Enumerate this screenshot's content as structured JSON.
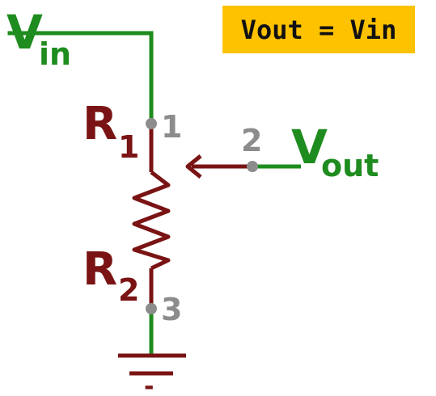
{
  "equation": {
    "text": "Vout = Vin",
    "background": "#FFC200"
  },
  "labels": {
    "vin_main": "V",
    "vin_sub": "in",
    "vout_main": "V",
    "vout_sub": "out",
    "r1_main": "R",
    "r1_sub": "1",
    "r2_main": "R",
    "r2_sub": "2",
    "pin1": "1",
    "pin2": "2",
    "pin3": "3",
    "ground_mark": "-"
  },
  "colors": {
    "wire": "#1E8C1E",
    "resistor": "#7A1414",
    "pin": "#8C8C8C"
  }
}
